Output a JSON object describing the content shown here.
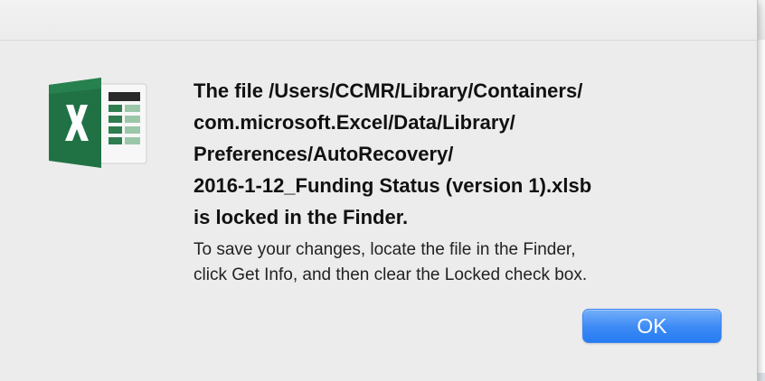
{
  "dialog": {
    "icon": "excel-app-icon",
    "title": "The file /Users/CCMR/Library/Containers/\ncom.microsoft.Excel/Data/Library/\nPreferences/AutoRecovery/\n2016-1-12_Funding Status (version 1).xlsb\nis locked in the Finder.",
    "body": "To save your changes, locate the file in the Finder,\nclick Get Info, and then clear the Locked check box.",
    "ok_label": "OK"
  },
  "colors": {
    "dialog_background": "#ececec",
    "accent_button": "#3c8af5",
    "excel_green": "#207245"
  }
}
